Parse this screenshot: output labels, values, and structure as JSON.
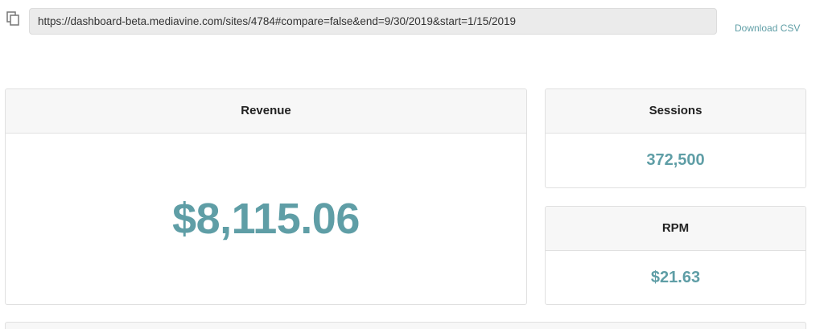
{
  "toolbar": {
    "copy_icon": "copy-icon",
    "url": "https://dashboard-beta.mediavine.com/sites/4784#compare=false&end=9/30/2019&start=1/15/2019",
    "download_label": "Download CSV"
  },
  "revenue": {
    "title": "Revenue",
    "value": "$8,115.06"
  },
  "sessions": {
    "title": "Sessions",
    "value": "372,500"
  },
  "rpm": {
    "title": "RPM",
    "value": "$21.63"
  },
  "colors": {
    "accent": "#5f9ea6",
    "header_bg": "#f7f7f7",
    "border": "#e0e0e0",
    "url_bg": "#ebebeb"
  }
}
